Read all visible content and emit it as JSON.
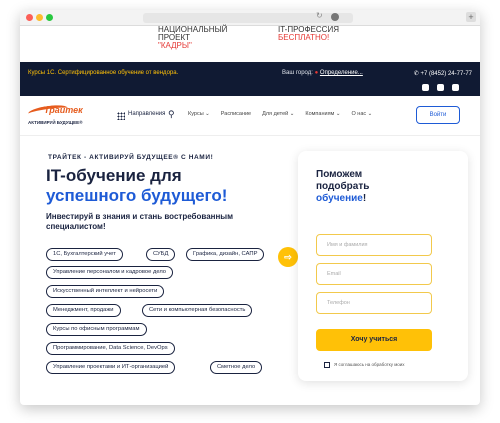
{
  "promo": {
    "left_line1": "НАЦИОНАЛЬНЫЙ",
    "left_line2": "ПРОЕКТ",
    "left_line3": "\"КАДРЫ\"",
    "right_line1": "IT-ПРОФЕССИЯ",
    "right_line2": "БЕСПЛАТНО!"
  },
  "topbar": {
    "message": "Курсы 1С. Сертифицированное обучение от вендора.",
    "city_label": "Ваш город:",
    "city_value": "Определение...",
    "phone": "+7 (8452) 24-77-77"
  },
  "nav": {
    "brand": "Трайтек",
    "brand_tagline": "АКТИВИРУЙ БУДУЩЕЕ®",
    "directions": "Направления",
    "menu": [
      "Курсы ⌄",
      "Расписание",
      "Для детей ⌄",
      "Компаниям ⌄",
      "О нас ⌄"
    ],
    "login": "Войти"
  },
  "hero": {
    "tagline": "ТРАЙТЕК - АКТИВИРУЙ БУДУЩЕЕ® С НАМИ!",
    "title_line1": "IT-обучение для",
    "title_line2": "успешного будущего!",
    "subtitle": "Инвестируй в знания и стань востребованным специалистом!",
    "pills": [
      "1С, Бухгалтерский учет",
      "СУБД",
      "Графика, дизайн, САПР",
      "Управление персоналом и кадровое дело",
      "Искусственный интеллект и нейросети",
      "Менеджмент, продажи",
      "Сети и компьютерная безопасность",
      "Курсы по офисным программам",
      "Программирование, Data Science, DevOps",
      "Управление проектами и ИТ-организацией",
      "Сметное дело"
    ]
  },
  "form": {
    "title_line1": "Поможем",
    "title_line2": "подобрать",
    "title_blue": "обучение",
    "title_end": "!",
    "name_placeholder": "Имя и фамилия",
    "email_placeholder": "Email",
    "phone_placeholder": "Телефон",
    "submit": "Хочу учиться",
    "consent": "Я соглашаюсь на обработку моих"
  },
  "colors": {
    "accent_blue": "#1e5bd6",
    "accent_yellow": "#ffc107",
    "dark": "#101a33",
    "brand_orange": "#e65c1e"
  }
}
